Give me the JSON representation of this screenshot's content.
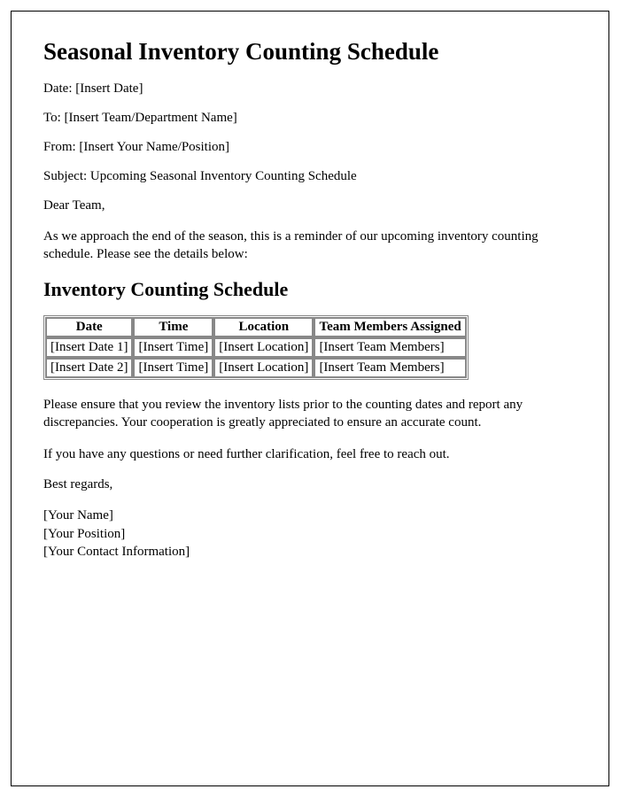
{
  "title": "Seasonal Inventory Counting Schedule",
  "date_line": "Date: [Insert Date]",
  "to_line": "To: [Insert Team/Department Name]",
  "from_line": "From: [Insert Your Name/Position]",
  "subject_line": "Subject: Upcoming Seasonal Inventory Counting Schedule",
  "salutation": "Dear Team,",
  "intro_paragraph": "As we approach the end of the season, this is a reminder of our upcoming inventory counting schedule. Please see the details below:",
  "schedule_heading": "Inventory Counting Schedule",
  "table": {
    "headers": {
      "date": "Date",
      "time": "Time",
      "location": "Location",
      "team": "Team Members Assigned"
    },
    "rows": [
      {
        "date": "[Insert Date 1]",
        "time": "[Insert Time]",
        "location": "[Insert Location]",
        "team": "[Insert Team Members]"
      },
      {
        "date": "[Insert Date 2]",
        "time": "[Insert Time]",
        "location": "[Insert Location]",
        "team": "[Insert Team Members]"
      }
    ]
  },
  "review_paragraph": "Please ensure that you review the inventory lists prior to the counting dates and report any discrepancies. Your cooperation is greatly appreciated to ensure an accurate count.",
  "questions_paragraph": "If you have any questions or need further clarification, feel free to reach out.",
  "closing": "Best regards,",
  "signature": {
    "name": "[Your Name]",
    "position": "[Your Position]",
    "contact": "[Your Contact Information]"
  }
}
